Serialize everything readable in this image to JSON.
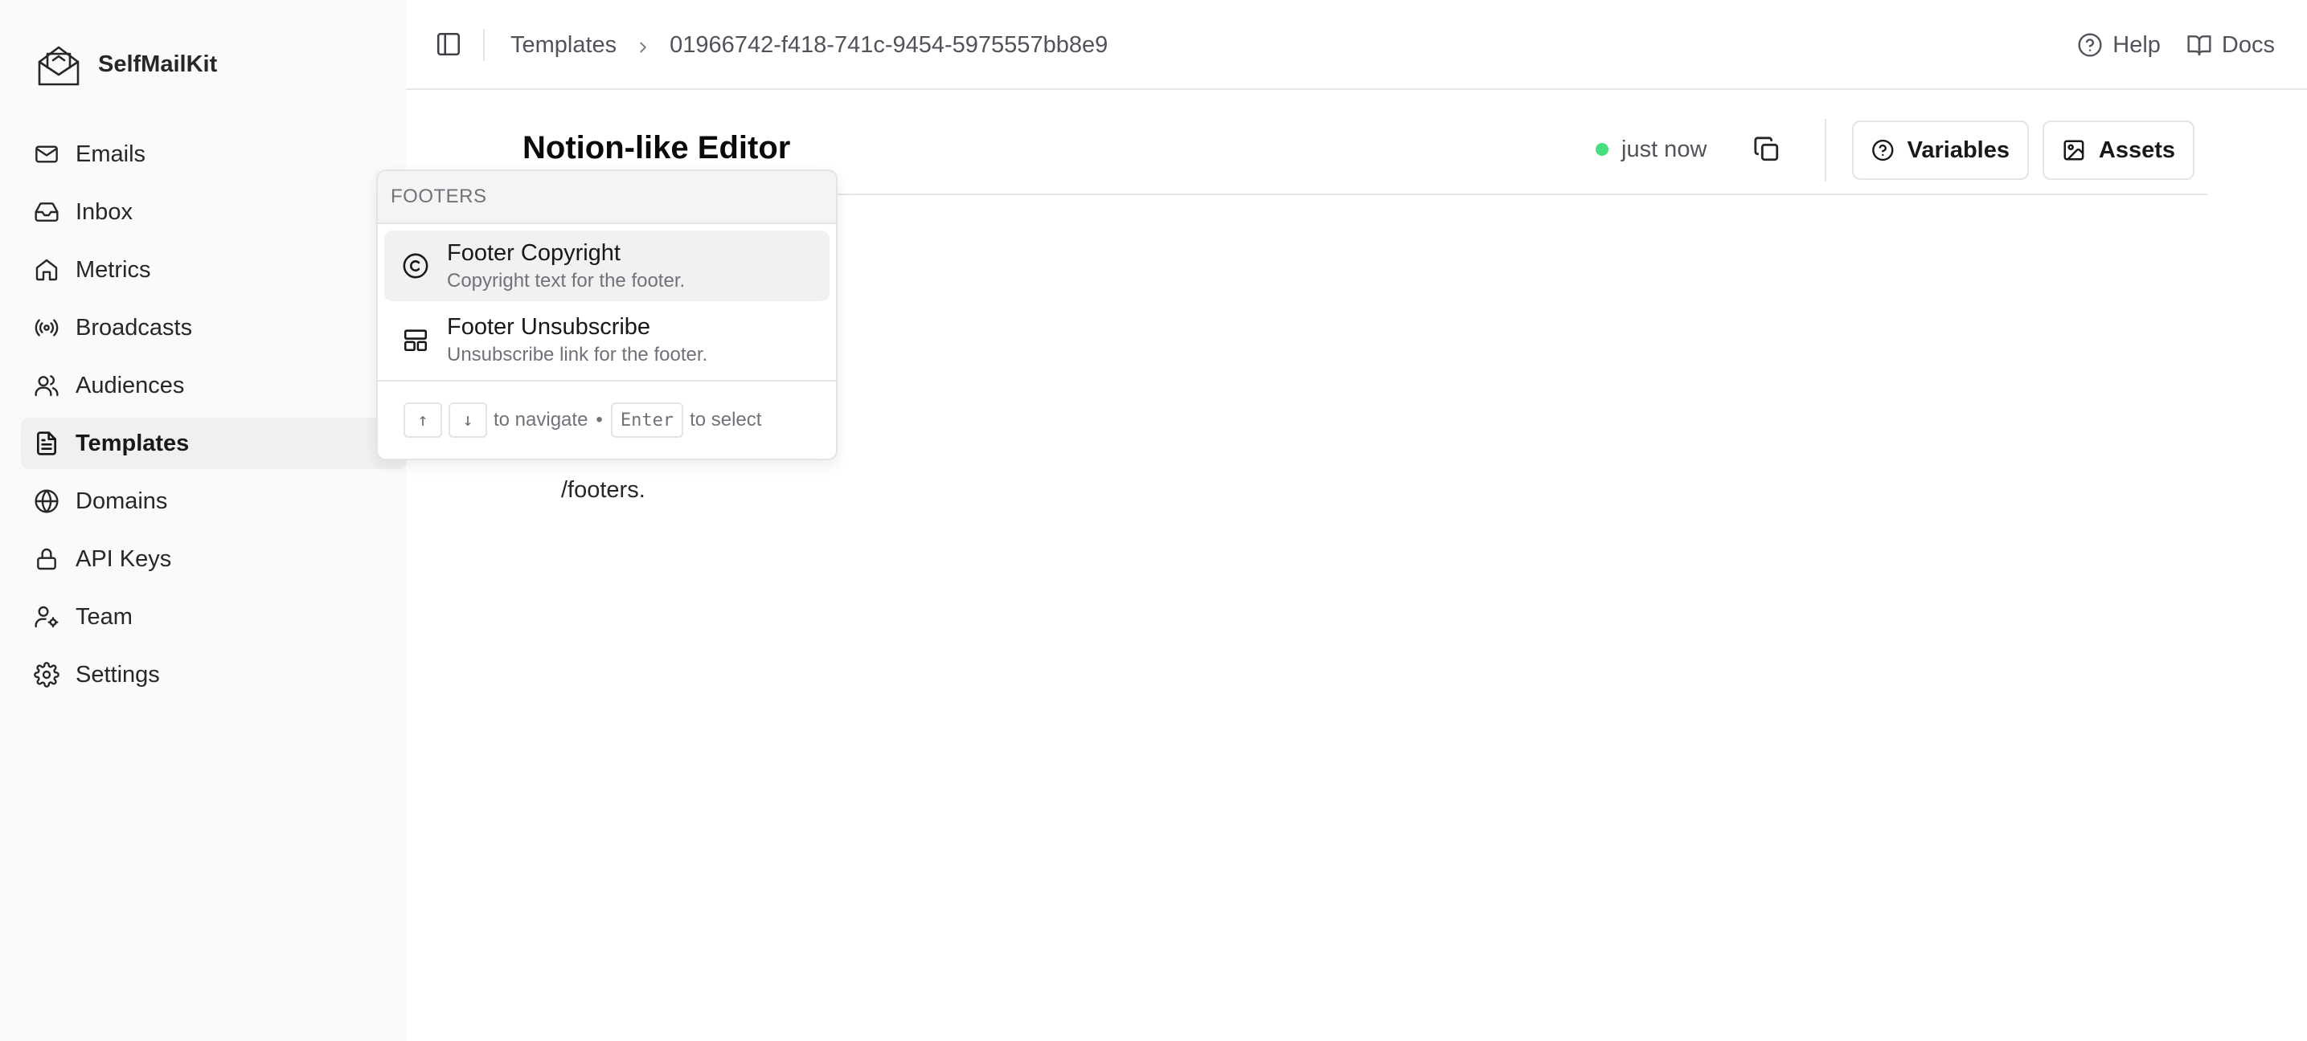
{
  "brand": {
    "name": "SelfMailKit"
  },
  "sidebar": {
    "items": [
      {
        "label": "Emails",
        "icon": "mail-icon",
        "active": false
      },
      {
        "label": "Inbox",
        "icon": "inbox-icon",
        "active": false
      },
      {
        "label": "Metrics",
        "icon": "home-icon",
        "active": false
      },
      {
        "label": "Broadcasts",
        "icon": "broadcast-icon",
        "active": false
      },
      {
        "label": "Audiences",
        "icon": "users-icon",
        "active": false
      },
      {
        "label": "Templates",
        "icon": "file-text-icon",
        "active": true
      },
      {
        "label": "Domains",
        "icon": "globe-icon",
        "active": false
      },
      {
        "label": "API Keys",
        "icon": "lock-icon",
        "active": false
      },
      {
        "label": "Team",
        "icon": "user-cog-icon",
        "active": false
      },
      {
        "label": "Settings",
        "icon": "gear-icon",
        "active": false
      }
    ]
  },
  "topbar": {
    "breadcrumb": [
      "Templates",
      "01966742-f418-741c-9454-5975557bb8e9"
    ],
    "help_label": "Help",
    "docs_label": "Docs"
  },
  "editor": {
    "title": "Notion-like Editor",
    "status": "just now",
    "status_color": "#4ade80",
    "variables_label": "Variables",
    "assets_label": "Assets",
    "body_text": "/footers."
  },
  "popover": {
    "header": "FOOTERS",
    "items": [
      {
        "title": "Footer Copyright",
        "description": "Copyright text for the footer.",
        "icon": "copyright-icon",
        "selected": true
      },
      {
        "title": "Footer Unsubscribe",
        "description": "Unsubscribe link for the footer.",
        "icon": "layout-icon",
        "selected": false
      }
    ],
    "footer": {
      "up_key": "↑",
      "down_key": "↓",
      "navigate_text": "to navigate",
      "separator": "•",
      "enter_key": "Enter",
      "select_text": "to select"
    }
  }
}
